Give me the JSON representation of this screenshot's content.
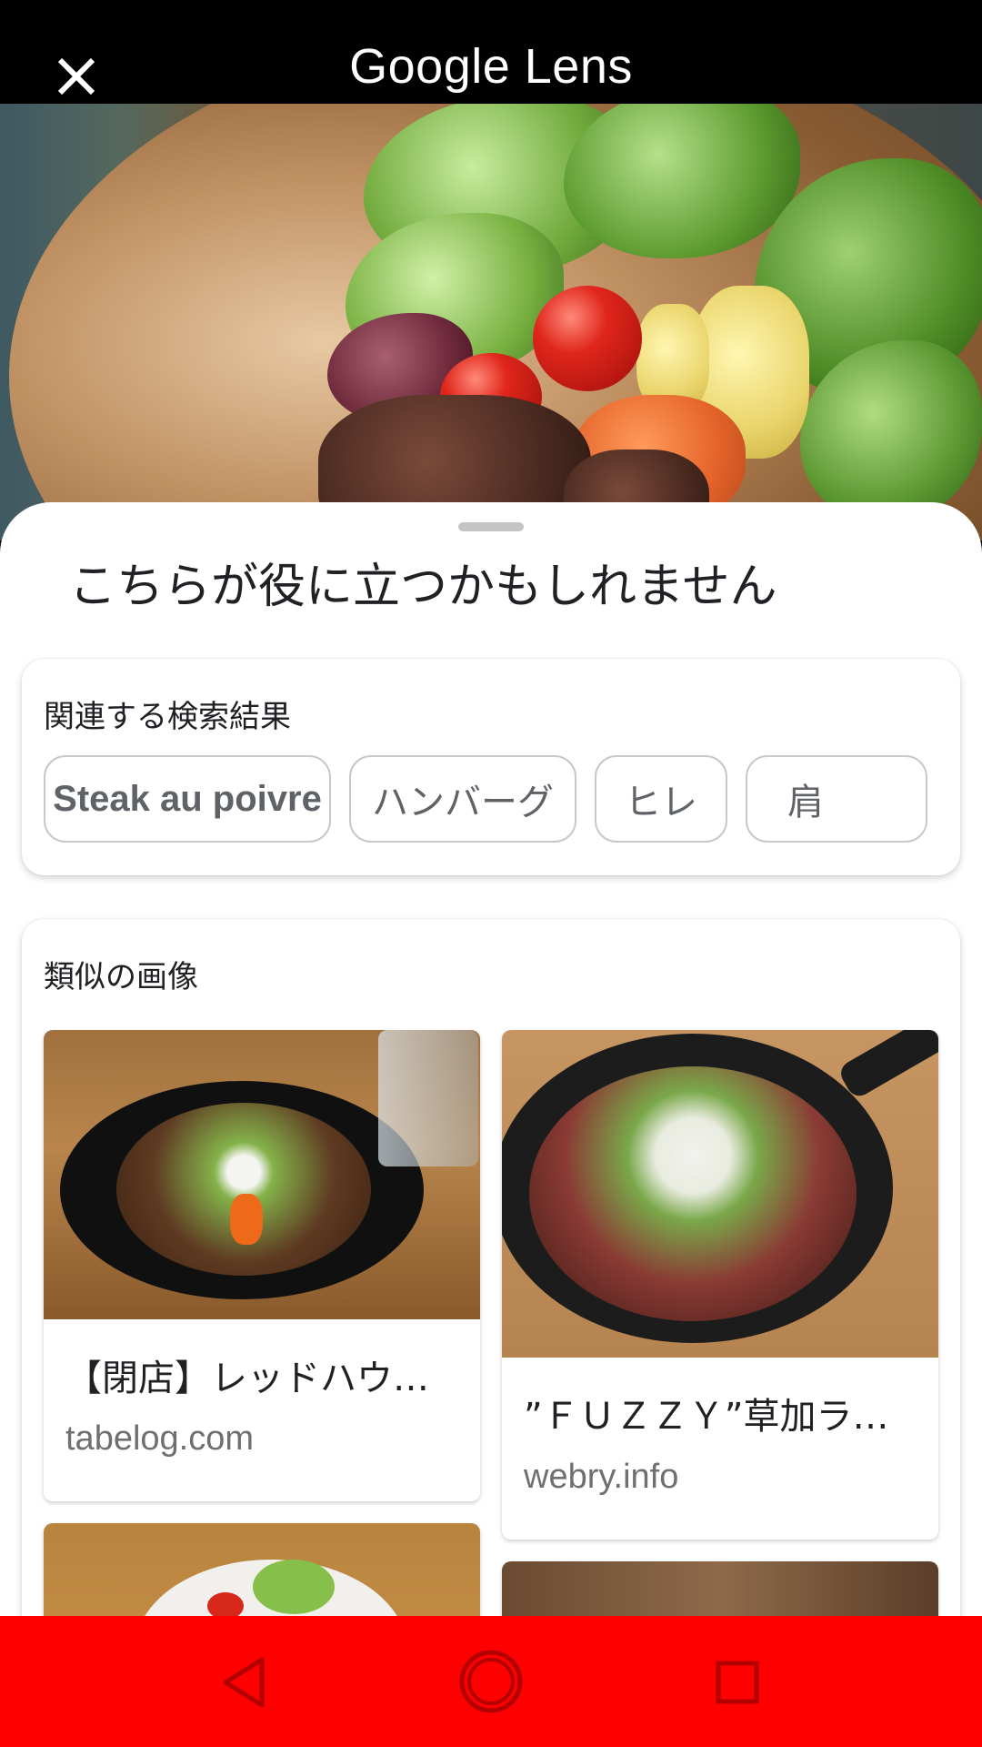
{
  "header": {
    "title": "Google Lens",
    "close_icon": "close-icon"
  },
  "sheet": {
    "heading": "こちらが役に立つかもしれません"
  },
  "related": {
    "title": "関連する検索結果",
    "chips": [
      "Steak au poivre",
      "ハンバーグ",
      "ヒレ",
      "肩"
    ]
  },
  "similar": {
    "title": "類似の画像",
    "results": [
      {
        "title": "【閉店】レッドハウ…",
        "source": "tabelog.com"
      },
      {
        "title": "”ＦＵＺＺＹ”草加ラ…",
        "source": "webry.info"
      }
    ]
  },
  "navbar": {
    "color": "#ff0000",
    "icons": [
      "back-icon",
      "home-icon",
      "recents-icon"
    ]
  }
}
